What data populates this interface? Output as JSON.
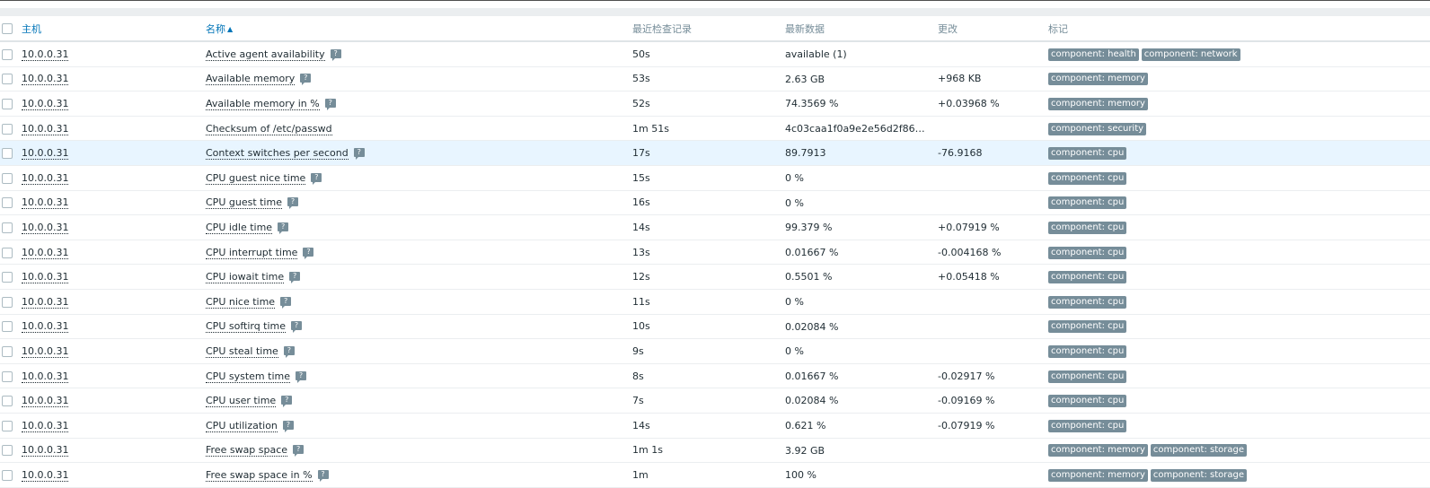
{
  "columns": {
    "host": "主机",
    "name": "名称",
    "last_check": "最近检查记录",
    "latest_data": "最新数据",
    "change": "更改",
    "tags": "标记"
  },
  "sort_indicator": "▲",
  "help_glyph": "?",
  "colors": {
    "link": "#0275b8",
    "tag_bg": "#768d99",
    "highlight_row": "#e8f5ff"
  },
  "rows": [
    {
      "host": "10.0.0.31",
      "name": "Active agent availability",
      "help": true,
      "last_check": "50s",
      "latest_data": "available (1)",
      "change": "",
      "tags": [
        "component: health",
        "component: network"
      ]
    },
    {
      "host": "10.0.0.31",
      "name": "Available memory",
      "help": true,
      "last_check": "53s",
      "latest_data": "2.63 GB",
      "change": "+968 KB",
      "tags": [
        "component: memory"
      ]
    },
    {
      "host": "10.0.0.31",
      "name": "Available memory in %",
      "help": true,
      "last_check": "52s",
      "latest_data": "74.3569 %",
      "change": "+0.03968 %",
      "tags": [
        "component: memory"
      ]
    },
    {
      "host": "10.0.0.31",
      "name": "Checksum of /etc/passwd",
      "help": false,
      "last_check": "1m 51s",
      "latest_data": "4c03caa1f0a9e2e56d2f86203e…",
      "change": "",
      "tags": [
        "component: security"
      ]
    },
    {
      "host": "10.0.0.31",
      "name": "Context switches per second",
      "help": true,
      "last_check": "17s",
      "latest_data": "89.7913",
      "change": "-76.9168",
      "tags": [
        "component: cpu"
      ],
      "highlight": true
    },
    {
      "host": "10.0.0.31",
      "name": "CPU guest nice time",
      "help": true,
      "last_check": "15s",
      "latest_data": "0 %",
      "change": "",
      "tags": [
        "component: cpu"
      ]
    },
    {
      "host": "10.0.0.31",
      "name": "CPU guest time",
      "help": true,
      "last_check": "16s",
      "latest_data": "0 %",
      "change": "",
      "tags": [
        "component: cpu"
      ]
    },
    {
      "host": "10.0.0.31",
      "name": "CPU idle time",
      "help": true,
      "last_check": "14s",
      "latest_data": "99.379 %",
      "change": "+0.07919 %",
      "tags": [
        "component: cpu"
      ]
    },
    {
      "host": "10.0.0.31",
      "name": "CPU interrupt time",
      "help": true,
      "last_check": "13s",
      "latest_data": "0.01667 %",
      "change": "-0.004168 %",
      "tags": [
        "component: cpu"
      ]
    },
    {
      "host": "10.0.0.31",
      "name": "CPU iowait time",
      "help": true,
      "last_check": "12s",
      "latest_data": "0.5501 %",
      "change": "+0.05418 %",
      "tags": [
        "component: cpu"
      ]
    },
    {
      "host": "10.0.0.31",
      "name": "CPU nice time",
      "help": true,
      "last_check": "11s",
      "latest_data": "0 %",
      "change": "",
      "tags": [
        "component: cpu"
      ]
    },
    {
      "host": "10.0.0.31",
      "name": "CPU softirq time",
      "help": true,
      "last_check": "10s",
      "latest_data": "0.02084 %",
      "change": "",
      "tags": [
        "component: cpu"
      ]
    },
    {
      "host": "10.0.0.31",
      "name": "CPU steal time",
      "help": true,
      "last_check": "9s",
      "latest_data": "0 %",
      "change": "",
      "tags": [
        "component: cpu"
      ]
    },
    {
      "host": "10.0.0.31",
      "name": "CPU system time",
      "help": true,
      "last_check": "8s",
      "latest_data": "0.01667 %",
      "change": "-0.02917 %",
      "tags": [
        "component: cpu"
      ]
    },
    {
      "host": "10.0.0.31",
      "name": "CPU user time",
      "help": true,
      "last_check": "7s",
      "latest_data": "0.02084 %",
      "change": "-0.09169 %",
      "tags": [
        "component: cpu"
      ]
    },
    {
      "host": "10.0.0.31",
      "name": "CPU utilization",
      "help": true,
      "last_check": "14s",
      "latest_data": "0.621 %",
      "change": "-0.07919 %",
      "tags": [
        "component: cpu"
      ]
    },
    {
      "host": "10.0.0.31",
      "name": "Free swap space",
      "help": true,
      "last_check": "1m 1s",
      "latest_data": "3.92 GB",
      "change": "",
      "tags": [
        "component: memory",
        "component: storage"
      ]
    },
    {
      "host": "10.0.0.31",
      "name": "Free swap space in %",
      "help": true,
      "last_check": "1m",
      "latest_data": "100 %",
      "change": "",
      "tags": [
        "component: memory",
        "component: storage"
      ]
    }
  ]
}
